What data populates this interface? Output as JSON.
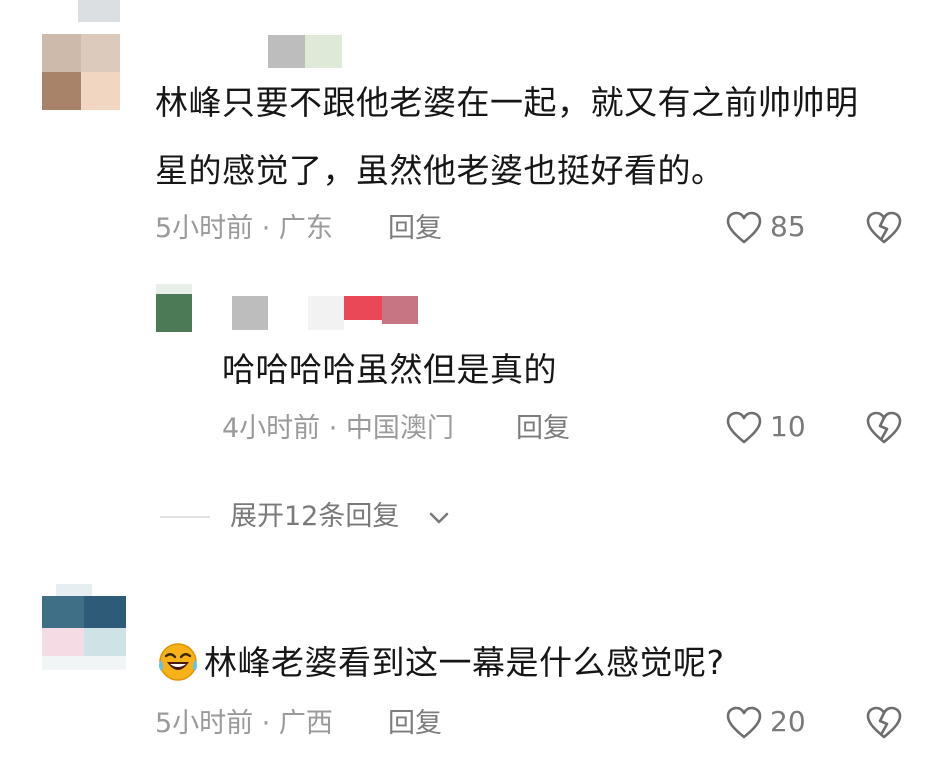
{
  "comments": [
    {
      "text_line1": "林峰只要不跟他老婆在一起，就又有之前帅帅明",
      "text_line2": "星的感觉了，虽然他老婆也挺好看的。",
      "meta": "5小时前 · 广东",
      "reply_label": "回复",
      "likes": "85"
    },
    {
      "text": "哈哈哈哈虽然但是真的",
      "meta": "4小时前 · 中国澳门",
      "reply_label": "回复",
      "likes": "10"
    },
    {
      "text": "林峰老婆看到这一幕是什么感觉呢?",
      "meta": "5小时前 · 广西",
      "reply_label": "回复",
      "likes": "20"
    }
  ],
  "expand_replies_label": "展开12条回复",
  "icons": {
    "like": "heart-icon",
    "dislike": "broken-heart-icon",
    "expand": "chevron-down-icon",
    "emoji": "laughing-crying-emoji-icon"
  },
  "colors": {
    "text": "#161616",
    "meta": "#9a9a9a",
    "icon": "#7a7a7a"
  }
}
